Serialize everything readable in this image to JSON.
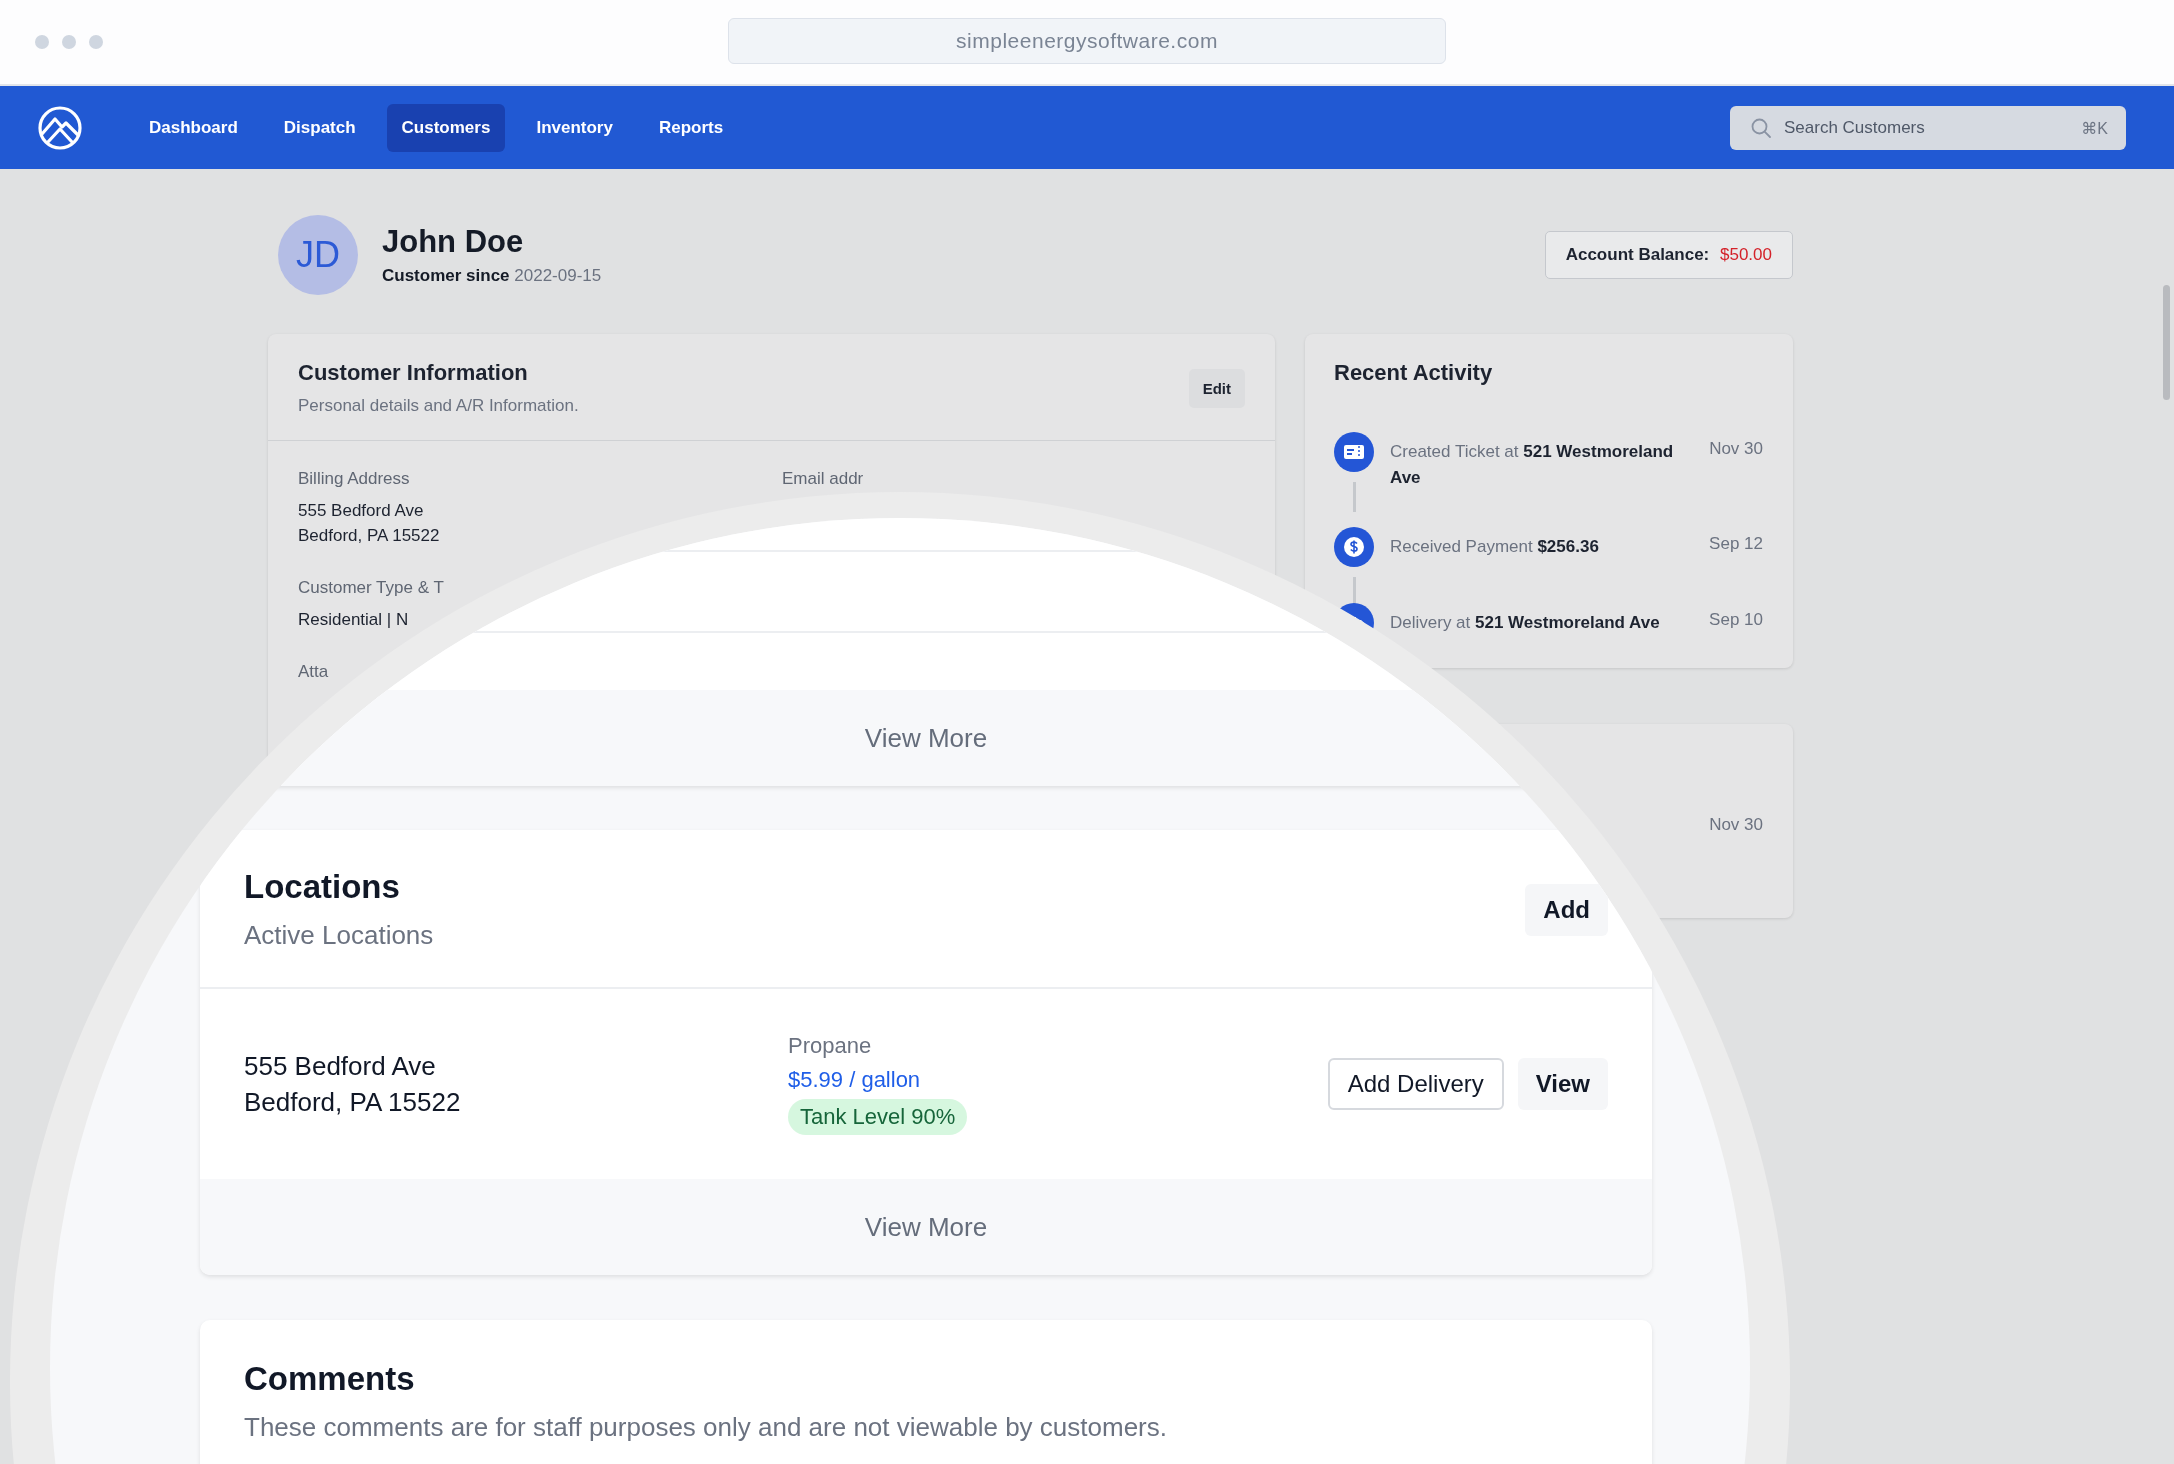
{
  "browser": {
    "url": "simpleenergysoftware.com"
  },
  "nav": {
    "items": [
      {
        "label": "Dashboard",
        "selected": false
      },
      {
        "label": "Dispatch",
        "selected": false
      },
      {
        "label": "Customers",
        "selected": true
      },
      {
        "label": "Inventory",
        "selected": false
      },
      {
        "label": "Reports",
        "selected": false
      }
    ],
    "search": {
      "placeholder": "Search Customers",
      "shortcut": "⌘K"
    }
  },
  "customer": {
    "initials": "JD",
    "name": "John Doe",
    "since_label": "Customer since",
    "since_date": "2022-09-15"
  },
  "account_balance": {
    "label": "Account Balance:",
    "value": "$50.00"
  },
  "customer_info": {
    "title": "Customer Information",
    "subtitle": "Personal details and A/R Information.",
    "edit": "Edit",
    "fields": [
      {
        "label": "Billing Address",
        "lines": [
          "555 Bedford Ave",
          "Bedford, PA 15522"
        ]
      },
      {
        "label": "Email addr"
      },
      {
        "label": "Customer Type & T",
        "lines": [
          "Residential | N"
        ]
      },
      {
        "label": "Atta"
      }
    ]
  },
  "recent_activity": {
    "title": "Recent Activity",
    "items": [
      {
        "kind": "ticket",
        "text": "Created Ticket at **521 Westmoreland Ave**",
        "date": "Nov 30"
      },
      {
        "kind": "payment",
        "text": "Received Payment **$256.36**",
        "date": "Sep 12"
      },
      {
        "kind": "delivery",
        "text": "Delivery at **521 Westmoreland Ave**",
        "date": "Sep 10"
      }
    ]
  },
  "second_card": {
    "date": "Nov 30"
  },
  "magnifier": {
    "info_view_more": "View More",
    "locations": {
      "title": "Locations",
      "subtitle": "Active Locations",
      "add": "Add",
      "rows": [
        {
          "address": [
            "555 Bedford Ave",
            "Bedford, PA 15522"
          ],
          "fuel": "Propane",
          "price": "$5.99 / gallon",
          "tank": "Tank Level 90%",
          "actions": [
            "Add Delivery",
            "View"
          ]
        }
      ],
      "view_more": "View More"
    },
    "comments": {
      "title": "Comments",
      "subtitle": "These comments are for staff purposes only and are not viewable by customers."
    }
  }
}
